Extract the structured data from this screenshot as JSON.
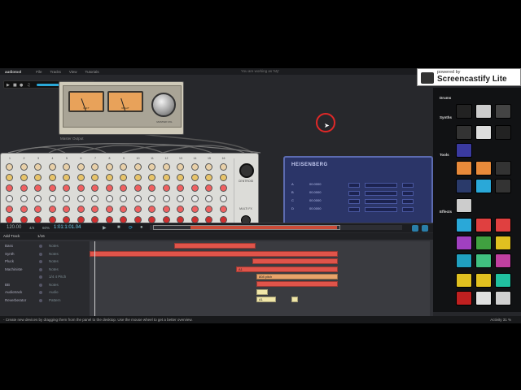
{
  "menubar": {
    "logo": "audiotool",
    "items": [
      "File",
      "Tracks",
      "View",
      "Tutorials"
    ],
    "status": "You are working as 'My'"
  },
  "watermark": {
    "small": "powered by",
    "big": "Screencastify Lite"
  },
  "master": {
    "left_label": "LEFT",
    "right_label": "RIGHT",
    "knob_label": "MASTER VOL",
    "caption": "Master Output"
  },
  "mixer": {
    "channels": [
      "1",
      "2",
      "3",
      "4",
      "5",
      "6",
      "7",
      "8",
      "9",
      "10",
      "11",
      "12",
      "13",
      "14",
      "15",
      "16"
    ],
    "main_label": "CENTROID",
    "aux_label": "MULTI FX"
  },
  "synth": {
    "title": "HEISENBERG",
    "rows": [
      "A",
      "B",
      "C",
      "D"
    ],
    "row_values": [
      "00.0000",
      "00.0000",
      "00.0000",
      "00.0000"
    ]
  },
  "browser": {
    "categories": [
      "Drums",
      "Synths",
      "Tools",
      "Effects"
    ]
  },
  "transport": {
    "bpm": "120.00",
    "signature": "4/4",
    "zoom": "60%",
    "position": "1:01:1:01.04"
  },
  "sequencer": {
    "add_track": "Add Track",
    "quantize": "1/16",
    "tracks": [
      {
        "name": "Bass",
        "instrument": "Notes"
      },
      {
        "name": "Synth",
        "instrument": "Notes"
      },
      {
        "name": "Pluck",
        "instrument": "Notes"
      },
      {
        "name": "Machiniste",
        "instrument": "Notes"
      },
      {
        "name": "",
        "instrument": "1/4 4 Pitch"
      },
      {
        "name": "BB",
        "instrument": "Notes"
      },
      {
        "name": "Audiotrack",
        "instrument": "Audio"
      },
      {
        "name": "Reverberator",
        "instrument": "Pattern"
      }
    ],
    "clip_labels": [
      "A1",
      "808 pitch",
      "A1"
    ]
  },
  "statusbar": {
    "text": "- Create new devices by dragging them from the panel to the desktop. Use the mouse wheel to get a better overview.",
    "activity": "Activity 31 %"
  },
  "colors": {
    "accent": "#2aa8d8",
    "clip_red": "#e0544a",
    "clip_orange": "#e8a46a",
    "clip_yellow": "#f0e6a8",
    "synth_bg": "#2b3568"
  }
}
